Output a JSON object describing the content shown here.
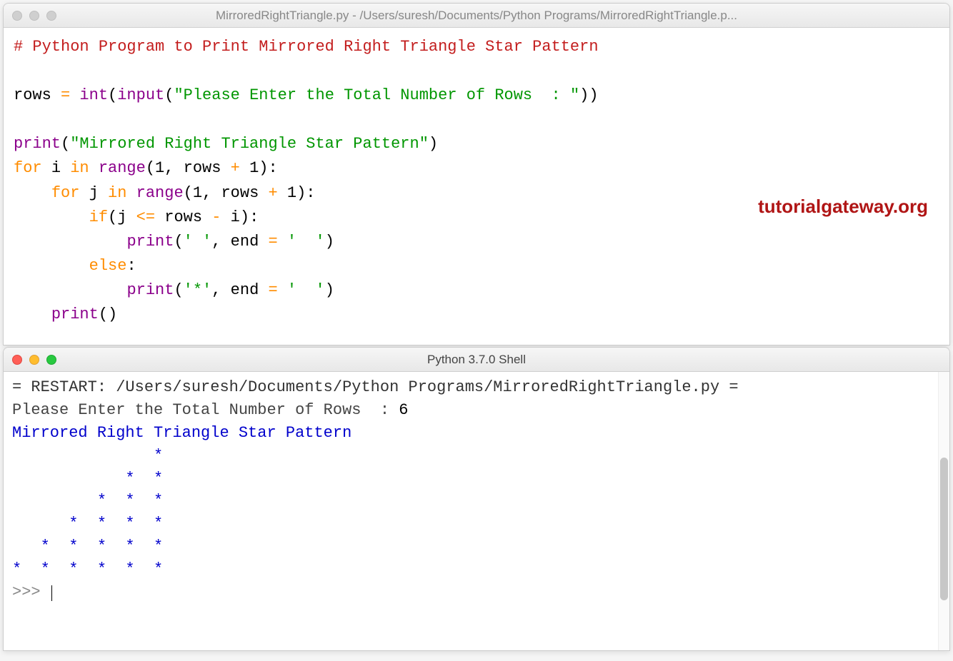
{
  "editor": {
    "title": "MirroredRightTriangle.py - /Users/suresh/Documents/Python Programs/MirroredRightTriangle.p...",
    "code": {
      "comment": "# Python Program to Print Mirrored Right Triangle Star Pattern",
      "l3_rows": "rows ",
      "l3_eq": "= ",
      "l3_int": "int",
      "l3_p1": "(",
      "l3_input": "input",
      "l3_p2": "(",
      "l3_str": "\"Please Enter the Total Number of Rows  : \"",
      "l3_p3": "))",
      "l5_print": "print",
      "l5_p1": "(",
      "l5_str": "\"Mirrored Right Triangle Star Pattern\"",
      "l5_p2": ")",
      "l6_for": "for ",
      "l6_i": "i ",
      "l6_in": "in ",
      "l6_range": "range",
      "l6_p1": "(",
      "l6_1": "1",
      "l6_c": ", rows ",
      "l6_plus": "+ ",
      "l6_1b": "1",
      "l6_p2": "):",
      "l7_ind": "    ",
      "l7_for": "for ",
      "l7_j": "j ",
      "l7_in": "in ",
      "l7_range": "range",
      "l7_p1": "(",
      "l7_1": "1",
      "l7_c": ", rows ",
      "l7_plus": "+ ",
      "l7_1b": "1",
      "l7_p2": "):",
      "l8_ind": "        ",
      "l8_if": "if",
      "l8_p1": "(j ",
      "l8_le": "<= ",
      "l8_rest": "rows ",
      "l8_minus": "- ",
      "l8_i": "i):",
      "l9_ind": "            ",
      "l9_print": "print",
      "l9_p1": "(",
      "l9_s1": "' '",
      "l9_c": ", end ",
      "l9_eq": "= ",
      "l9_s2": "'  '",
      "l9_p2": ")",
      "l10_ind": "        ",
      "l10_else": "else",
      "l10_colon": ":",
      "l11_ind": "            ",
      "l11_print": "print",
      "l11_p1": "(",
      "l11_s1": "'*'",
      "l11_c": ", end ",
      "l11_eq": "= ",
      "l11_s2": "'  '",
      "l11_p2": ")",
      "l12_ind": "    ",
      "l12_print": "print",
      "l12_p": "()"
    },
    "watermark": "tutorialgateway.org"
  },
  "shell": {
    "title": "Python 3.7.0 Shell",
    "restart": "= RESTART: /Users/suresh/Documents/Python Programs/MirroredRightTriangle.py =",
    "prompt_line_prefix": "Please Enter the Total Number of Rows  : ",
    "prompt_input": "6",
    "out_header": "Mirrored Right Triangle Star Pattern",
    "pattern_line1": "               *  ",
    "pattern_line2": "            *  *  ",
    "pattern_line3": "         *  *  *  ",
    "pattern_line4": "      *  *  *  *  ",
    "pattern_line5": "   *  *  *  *  *  ",
    "pattern_line6": "*  *  *  *  *  *  ",
    "ppp": ">>> "
  }
}
